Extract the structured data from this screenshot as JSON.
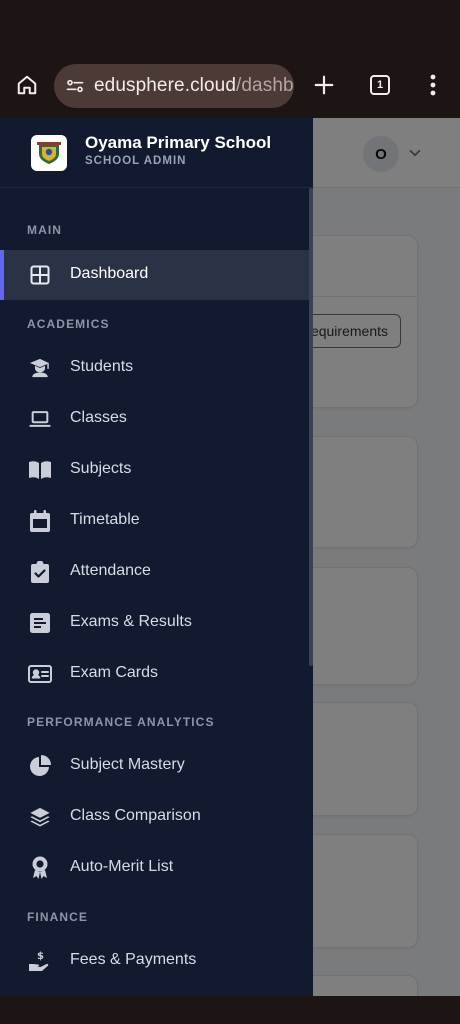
{
  "browser": {
    "url_host": "edusphere.cloud",
    "url_path": "/dashbo",
    "tab_count": "1"
  },
  "page": {
    "avatar_initial": "O",
    "requirements_button": "equirements"
  },
  "drawer": {
    "school_name": "Oyama Primary School",
    "role": "SCHOOL ADMIN",
    "sections": {
      "main": "MAIN",
      "academics": "ACADEMICS",
      "analytics": "PERFORMANCE ANALYTICS",
      "finance": "FINANCE"
    },
    "items": {
      "dashboard": "Dashboard",
      "students": "Students",
      "classes": "Classes",
      "subjects": "Subjects",
      "timetable": "Timetable",
      "attendance": "Attendance",
      "exams": "Exams & Results",
      "exam_cards": "Exam Cards",
      "subject_mastery": "Subject Mastery",
      "class_comparison": "Class Comparison",
      "merit_list": "Auto-Merit List",
      "fees": "Fees & Payments"
    },
    "active_item": "dashboard"
  },
  "colors": {
    "drawer_bg": "#111a2e",
    "active_bg": "#2a3346",
    "accent": "#6366f1",
    "browser_bg": "#1d1414",
    "url_pill": "#4b3a36"
  }
}
